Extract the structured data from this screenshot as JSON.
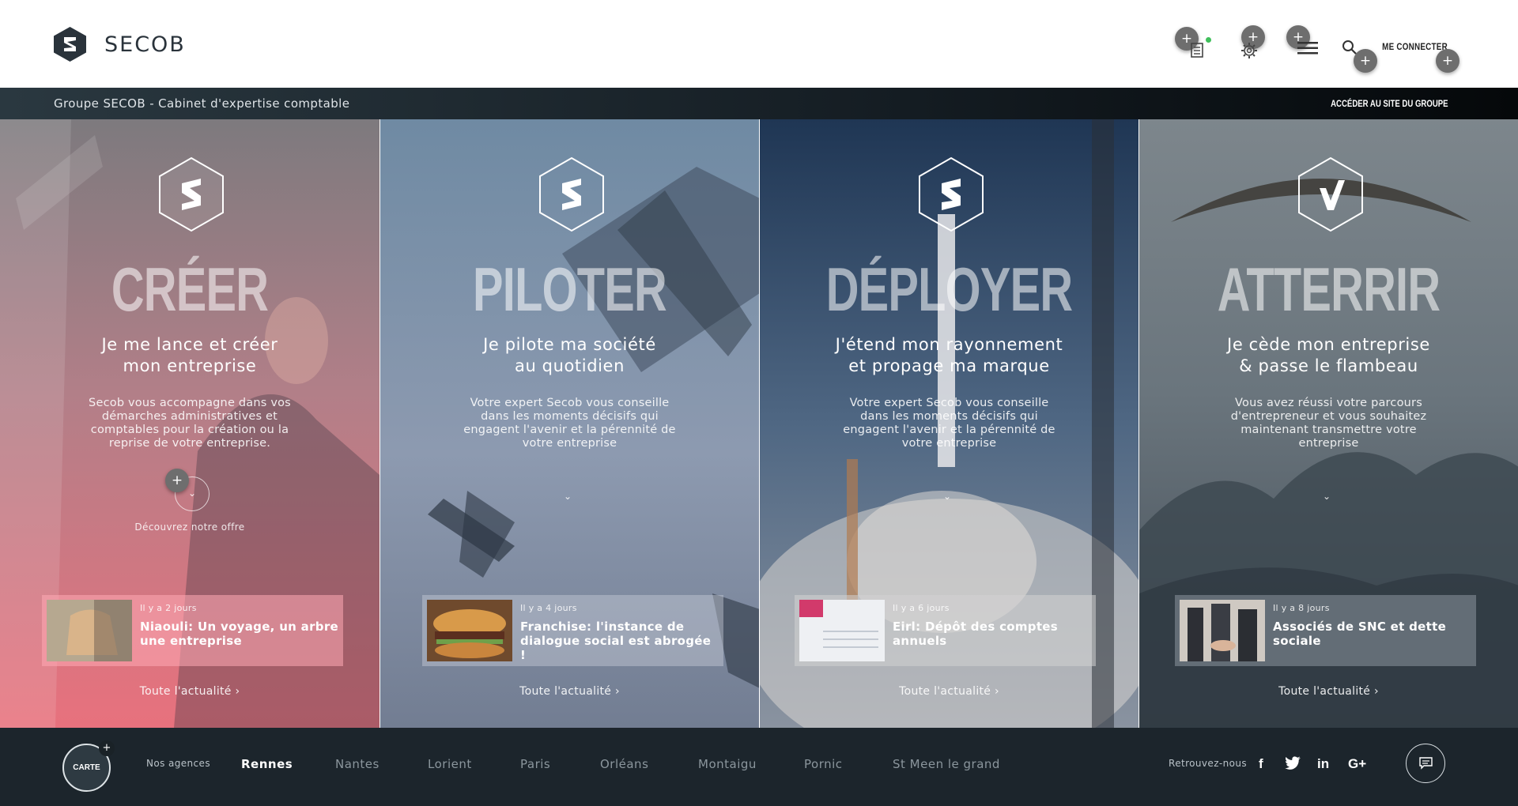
{
  "header": {
    "brand": "SECOB",
    "login_label": "ME CONNECTER"
  },
  "groupbar": {
    "title": "Groupe SECOB - Cabinet d'expertise comptable",
    "link_label": "ACCÉDER AU SITE DU GROUPE"
  },
  "panels": [
    {
      "title": "CRÉER",
      "subtitle_line1": "Je me lance et créer",
      "subtitle_line2": "mon entreprise",
      "description": "Secob vous accompagne dans vos démarches administratives et comptables pour la création ou la reprise de votre entreprise.",
      "cta_label": "Découvrez notre offre",
      "news_date": "Il y a 2 jours",
      "news_title": "Niaouli: Un voyage, un arbre une entreprise",
      "all_news": "Toute l'actualité",
      "accent": "#e77b86"
    },
    {
      "title": "PILOTER",
      "subtitle_line1": "Je pilote ma société",
      "subtitle_line2": "au quotidien",
      "description": "Votre expert Secob vous conseille dans les moments décisifs qui engagent l'avenir et la pérennité de votre entreprise",
      "news_date": "Il y a 4 jours",
      "news_title": "Franchise: l'instance de dialogue social est abrogée !",
      "all_news": "Toute l'actualité",
      "accent": "#7d90a4"
    },
    {
      "title": "DÉPLOYER",
      "subtitle_line1": "J'étend mon rayonnement",
      "subtitle_line2": "et propage ma marque",
      "description": "Votre expert Secob vous conseille dans les moments décisifs qui engagent l'avenir et la pérennité de votre entreprise",
      "news_date": "Il y a 6 jours",
      "news_title": "Eirl: Dépôt des comptes annuels",
      "all_news": "Toute l'actualité",
      "accent": "#3e5d7c"
    },
    {
      "title": "ATTERRIR",
      "subtitle_line1": "Je cède mon entreprise",
      "subtitle_line2": "& passe le flambeau",
      "description": "Vous avez réussi votre parcours d'entrepreneur et vous souhaitez maintenant transmettre votre entreprise",
      "news_date": "Il y a 8 jours",
      "news_title": "Associés de SNC et dette sociale",
      "all_news": "Toute l'actualité",
      "accent": "#5e6a73"
    }
  ],
  "footer": {
    "map_label": "CARTE",
    "agencies_label": "Nos agences",
    "agencies": [
      "Rennes",
      "Nantes",
      "Lorient",
      "Paris",
      "Orléans",
      "Montaigu",
      "Pornic",
      "St Meen le grand"
    ],
    "active_agency": "Rennes",
    "follow_label": "Retrouvez-nous",
    "social": [
      "facebook-icon",
      "twitter-icon",
      "linkedin-icon",
      "google-plus-icon"
    ],
    "social_glyphs": [
      "f",
      "🐦",
      "in",
      "G+"
    ]
  }
}
